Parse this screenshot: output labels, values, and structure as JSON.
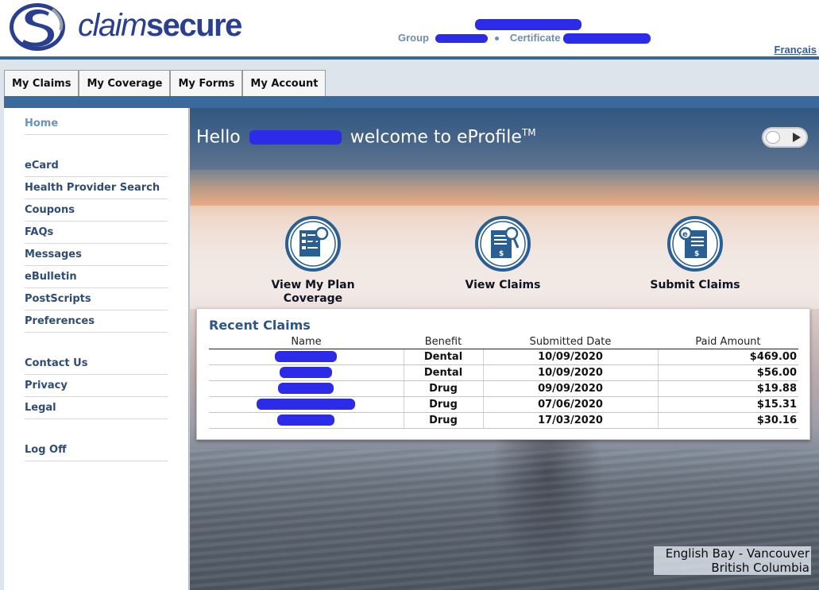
{
  "header": {
    "logo_text_part1": "claim",
    "logo_text_part2": "secure",
    "group_label": "Group",
    "certificate_label": "Certificate",
    "language_link": "Français"
  },
  "tabs": [
    {
      "label": "My Claims"
    },
    {
      "label": "My Coverage"
    },
    {
      "label": "My Forms"
    },
    {
      "label": "My Account"
    }
  ],
  "sidebar": {
    "items": [
      {
        "label": "Home"
      },
      {
        "label": "eCard"
      },
      {
        "label": "Health Provider Search"
      },
      {
        "label": "Coupons"
      },
      {
        "label": "FAQs"
      },
      {
        "label": "Messages"
      },
      {
        "label": "eBulletin"
      },
      {
        "label": "PostScripts"
      },
      {
        "label": "Preferences"
      },
      {
        "label": "Contact Us"
      },
      {
        "label": "Privacy"
      },
      {
        "label": "Legal"
      },
      {
        "label": "Log Off"
      }
    ]
  },
  "welcome": {
    "hello": "Hello",
    "rest": "welcome to eProfile",
    "tm": "TM"
  },
  "actions": [
    {
      "label_line1": "View My Plan",
      "label_line2": "Coverage",
      "icon": "plan-coverage-icon"
    },
    {
      "label_line1": "View Claims",
      "label_line2": "",
      "icon": "view-claims-icon"
    },
    {
      "label_line1": "Submit Claims",
      "label_line2": "",
      "icon": "submit-claims-icon"
    }
  ],
  "recent_claims": {
    "title": "Recent Claims",
    "columns": [
      "Name",
      "Benefit",
      "Submitted Date",
      "Paid Amount"
    ],
    "rows": [
      {
        "benefit": "Dental",
        "date": "10/09/2020",
        "amount": "$469.00"
      },
      {
        "benefit": "Dental",
        "date": "10/09/2020",
        "amount": "$56.00"
      },
      {
        "benefit": "Drug",
        "date": "09/09/2020",
        "amount": "$19.88"
      },
      {
        "benefit": "Drug",
        "date": "07/06/2020",
        "amount": "$15.31"
      },
      {
        "benefit": "Drug",
        "date": "17/03/2020",
        "amount": "$30.16"
      }
    ]
  },
  "caption": {
    "line1": "English Bay - Vancouver",
    "line2": "British Columbia"
  },
  "colors": {
    "brand_navy": "#2a3f8f",
    "nav_blue": "#3a6a9b",
    "link_blue": "#2f4c74",
    "redaction": "#2b2be8"
  }
}
